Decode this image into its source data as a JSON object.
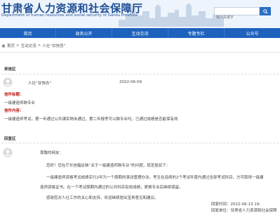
{
  "header": {
    "title": "甘肃省人力资源和社会保障厅",
    "subtitle": "Department of human resources and social security of Gansu Province",
    "search_placeholder": "输入关键字"
  },
  "nav": [
    "首页",
    "政务公开",
    "互动交流",
    "专题专栏",
    "公众号"
  ],
  "breadcrumb": [
    "首页",
    "互动交流",
    "人社“甘快答”"
  ],
  "letter": {
    "section_label": "来信区",
    "name": "人社“甘快办”",
    "date": "2022-06-09",
    "title_label": "信件标题：",
    "title": "一级建造师跨专业",
    "content_label": "信件内容：",
    "content": "一级建造师考试，第一年通过公共课实物未通过，第二年报考可以跨专业吗，已通过成绩是否能保有效"
  },
  "reply": {
    "section_label": "回复区",
    "greeting": "尊敬的网友：",
    "para1": "您好！您在厅长信箱反映“关于一级建造师跨专业”的问题，现答复如下：",
    "para2a": "一级建造师资格考试成绩实行2年为一个周期的滚动管理办法。考生在连续的2个考试年度内通过全部考试科目，方可取得一级建",
    "para2b": "造师资格证书。在一个考试周期内通过的公共科目有效成绩，更换专业后继续保留。",
    "para3": "感谢您对人社工作的关心和支持，欢迎继续提出宝贵意见和建议。",
    "time_label": "回复时间：",
    "time": "2022-06-13 19:",
    "org_label": "回复单位：",
    "org": "甘肃省人力资源和社会保障"
  }
}
